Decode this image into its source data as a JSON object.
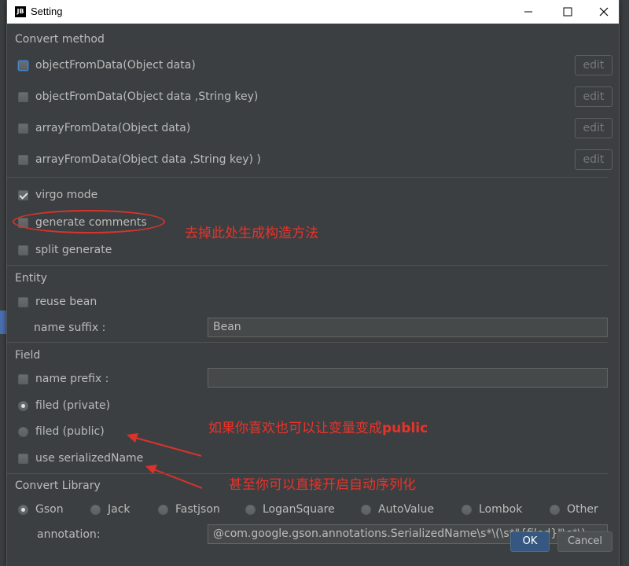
{
  "window": {
    "title": "Setting",
    "app_icon": "JB"
  },
  "convert_method": {
    "heading": "Convert method",
    "methods": [
      {
        "label": "objectFromData(Object data)",
        "checked": false
      },
      {
        "label": "objectFromData(Object data ,String key)",
        "checked": false
      },
      {
        "label": "arrayFromData(Object data)",
        "checked": false
      },
      {
        "label": "arrayFromData(Object data ,String key) )",
        "checked": false
      }
    ],
    "edit_label": "edit"
  },
  "options": {
    "virgo_mode": "virgo mode",
    "generate_comments": "generate comments",
    "split_generate": "split generate"
  },
  "entity": {
    "heading": "Entity",
    "reuse_bean": "reuse bean",
    "name_suffix_label": "name suffix :",
    "name_suffix_value": "Bean"
  },
  "field": {
    "heading": "Field",
    "name_prefix_label": "name prefix :",
    "name_prefix_value": "",
    "filed_private": "filed (private)",
    "filed_public": "filed (public)",
    "use_serialized_name": "use serializedName"
  },
  "convert_library": {
    "heading": "Convert Library",
    "libraries": [
      "Gson",
      "Jack",
      "Fastjson",
      "LoganSquare",
      "AutoValue",
      "Lombok",
      "Other"
    ],
    "selected": "Gson",
    "annotation_label": "annotation:",
    "annotation_value": "@com.google.gson.annotations.SerializedName\\s*\\(\\s*\"{filed}\"\\s*\\)"
  },
  "annotations": {
    "remove_constructor": "去掉此处生成构造方法",
    "public_note_prefix": "如果你喜欢也可以让变量变成",
    "public_note_bold": "public",
    "serialize_note": "甚至你可以直接开启自动序列化"
  },
  "buttons": {
    "ok": "OK",
    "cancel": "Cancel"
  },
  "colors": {
    "background": "#3c3f41",
    "text": "#bbbbbb",
    "annotation": "#e8332a",
    "ok_button": "#365880"
  }
}
